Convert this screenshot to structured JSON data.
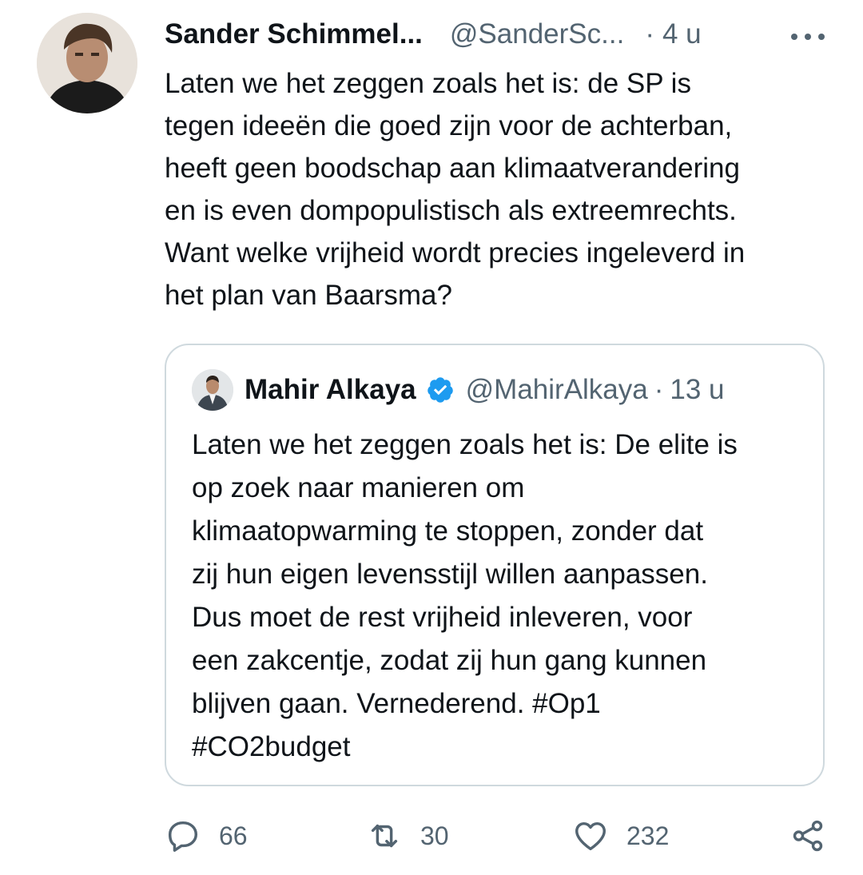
{
  "tweet": {
    "author_name": "Sander Schimmel...",
    "author_handle": "@SanderSc...",
    "time": "4 u",
    "separator": "·",
    "lines": [
      "Laten we het zeggen zoals het is: de SP is",
      "tegen ideeën die goed zijn voor de achterban,",
      "heeft geen boodschap aan klimaatverandering",
      "en is even dompopulistisch als extreemrechts.",
      "Want welke vrijheid wordt precies ingeleverd in",
      "het plan van Baarsma?"
    ]
  },
  "quoted_tweet": {
    "author_name": "Mahir Alkaya",
    "author_handle": "@MahirAlkaya",
    "separator": "·",
    "time": "13 u",
    "verified_icon": "verified-badge-icon",
    "lines": [
      "Laten we het zeggen zoals het is: De elite is",
      "op zoek naar manieren om",
      "klimaatopwarming te stoppen, zonder dat",
      "zij hun eigen levensstijl willen aanpassen.",
      "Dus moet de rest vrijheid inleveren, voor",
      "een zakcentje, zodat zij hun gang kunnen",
      "blijven gaan. Vernederend. #Op1",
      "#CO2budget"
    ]
  },
  "actions": {
    "replies": "66",
    "retweets": "30",
    "likes": "232"
  },
  "colors": {
    "text": "#0f1419",
    "secondary": "#536471",
    "border": "#cfd9de",
    "verified": "#1d9bf0"
  }
}
